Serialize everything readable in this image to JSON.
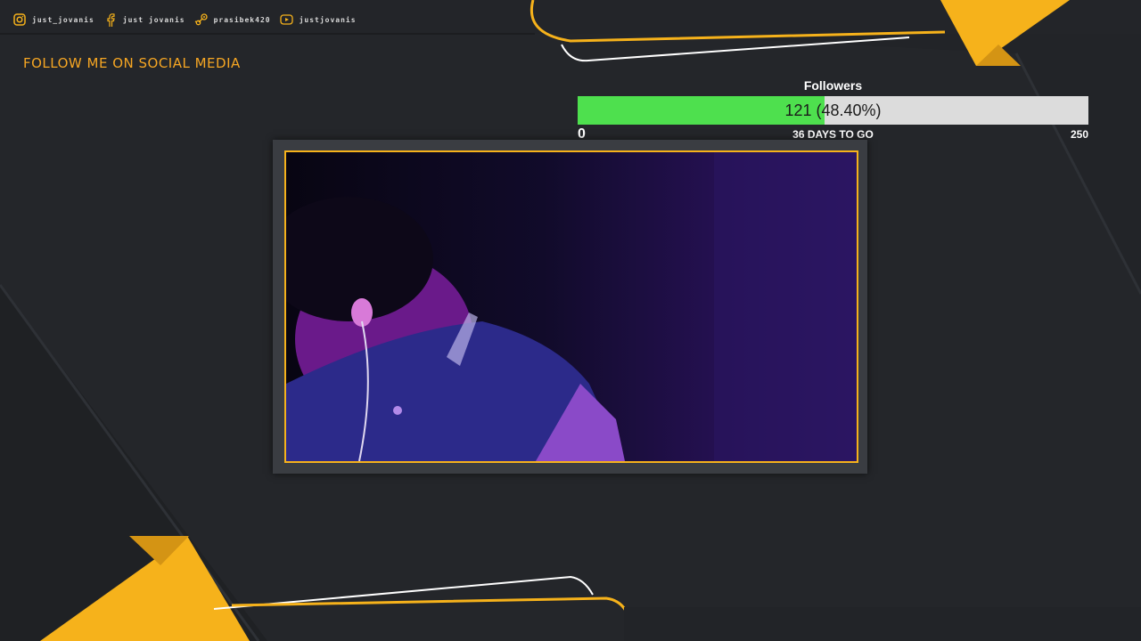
{
  "social": {
    "items": [
      {
        "icon": "instagram-icon",
        "label": "just_jovanis"
      },
      {
        "icon": "facebook-icon",
        "label": "just jovanis"
      },
      {
        "icon": "steam-icon",
        "label": "prasibek420"
      },
      {
        "icon": "youtube-icon",
        "label": "justjovanis"
      }
    ],
    "title": "FOLLOW ME ON SOCIAL MEDIA"
  },
  "goal": {
    "title": "Followers",
    "current": 121,
    "target": 250,
    "progress": 0.484,
    "value_text": "121 (48.40%)",
    "min_label": "0",
    "max_label": "250",
    "days_text": "36 DAYS TO GO"
  },
  "colors": {
    "background": "#24262a",
    "accent": "#f6b21b",
    "accent_text": "#f6a623",
    "goal_fill": "#4ee04e",
    "goal_track": "#dcdcdc"
  }
}
